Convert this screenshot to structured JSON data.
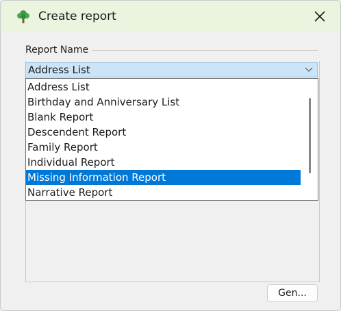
{
  "window": {
    "title": "Create report",
    "icon": "tree-icon",
    "close_icon": "close-icon"
  },
  "report_name": {
    "label": "Report Name",
    "selected_value": "Address List",
    "options": [
      "Address List",
      "Birthday and Anniversary List",
      "Blank Report",
      "Descendent Report",
      "Family Report",
      "Individual Report",
      "Missing Information Report",
      "Narrative Report"
    ],
    "highlighted_option": "Missing Information Report"
  },
  "buttons": {
    "generate_label": "Gen..."
  },
  "colors": {
    "titlebar": "#eaf4df",
    "combo_background": "#cce4f7",
    "highlight": "#0078d7",
    "tree_green": "#3f9b4a",
    "tree_trunk": "#8a5a2b"
  }
}
